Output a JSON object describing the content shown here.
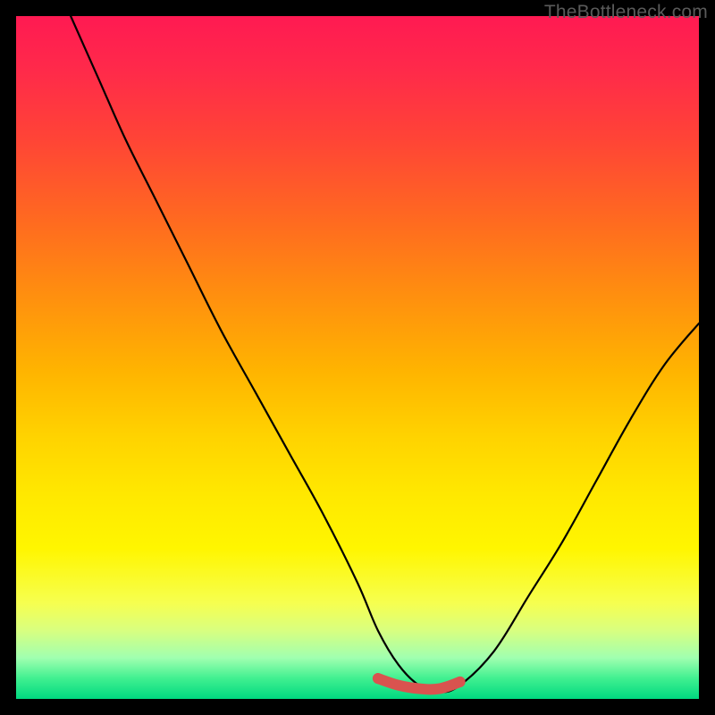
{
  "watermark": "TheBottleneck.com",
  "chart_data": {
    "type": "line",
    "title": "",
    "xlabel": "",
    "ylabel": "",
    "xlim": [
      0,
      100
    ],
    "ylim": [
      0,
      100
    ],
    "background": "rainbow-gradient-red-to-green",
    "series": [
      {
        "name": "bottleneck-curve",
        "x": [
          8,
          12,
          16,
          20,
          25,
          30,
          35,
          40,
          45,
          50,
          53,
          56,
          59,
          62,
          65,
          70,
          75,
          80,
          85,
          90,
          95,
          100
        ],
        "y": [
          100,
          91,
          82,
          74,
          64,
          54,
          45,
          36,
          27,
          17,
          10,
          5,
          2,
          1,
          2,
          7,
          15,
          23,
          32,
          41,
          49,
          55
        ],
        "color": "#000000"
      },
      {
        "name": "bottleneck-sweet-spot",
        "x": [
          53,
          56,
          59,
          62,
          65
        ],
        "y": [
          3,
          2,
          1.5,
          1.5,
          2.5
        ],
        "color": "#d9534f",
        "thick": true
      }
    ]
  }
}
